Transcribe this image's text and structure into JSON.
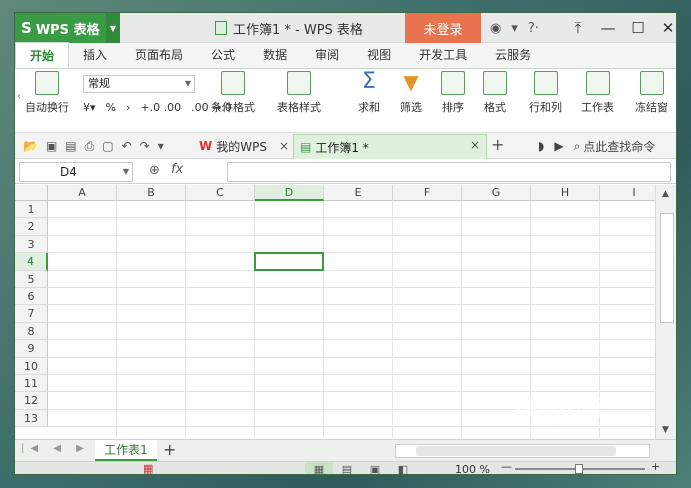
{
  "app": {
    "name": "WPS 表格",
    "doc_title": "工作簿1 * - WPS 表格",
    "login": "未登录"
  },
  "ribbon_tabs": [
    "开始",
    "插入",
    "页面布局",
    "公式",
    "数据",
    "审阅",
    "视图",
    "开发工具",
    "云服务"
  ],
  "ribbon": {
    "wrap_text": "自动换行",
    "number_format": "常规",
    "percent": "%",
    "comma": "›",
    "dec_inc": "+.0 .00",
    "dec_dec": ".00 →.0",
    "buttons": [
      "条件格式",
      "表格样式",
      "求和",
      "筛选",
      "排序",
      "格式",
      "行和列",
      "工作表",
      "冻结窗"
    ]
  },
  "quickbar": {
    "tab_mywps": "我的WPS",
    "tab_book": "工作簿1 *",
    "search": "点此查找命令"
  },
  "formula": {
    "namebox": "D4",
    "fx": "fx",
    "value": ""
  },
  "grid": {
    "columns": [
      "A",
      "B",
      "C",
      "D",
      "E",
      "F",
      "G",
      "H",
      "I"
    ],
    "rows": [
      "1",
      "2",
      "3",
      "4",
      "5",
      "6",
      "7",
      "8",
      "9",
      "10",
      "11",
      "12",
      "13"
    ],
    "selected_col": "D",
    "selected_row": "4"
  },
  "sheets": {
    "tabs": [
      "工作表1"
    ]
  },
  "status": {
    "zoom": "100 %"
  },
  "watermark": {
    "brand": "搜狗指南",
    "url": "zhinan.sogou.com"
  },
  "colors": {
    "accent": "#3a9b45",
    "login_bg": "#e8734f"
  }
}
